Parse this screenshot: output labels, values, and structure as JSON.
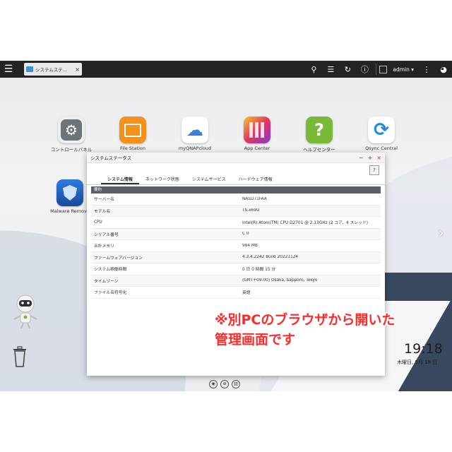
{
  "topbar": {
    "tab_label": "システムステ...",
    "tab_close": "×",
    "user": "admin ▾",
    "icons": [
      "menu-icon",
      "search-icon",
      "stack-icon",
      "sync-icon",
      "info-icon",
      "user-icon",
      "more-icon",
      "dashboard-icon"
    ]
  },
  "desktop": {
    "icons": [
      {
        "label": "コントロールパネル",
        "color": "#7a7f86",
        "icon": "gear-icon",
        "glyph": "⚙"
      },
      {
        "label": "File Station",
        "color": "#f2921d",
        "icon": "folder-icon",
        "glyph": "▬"
      },
      {
        "label": "myQNAPcloud",
        "color": "#ffffff",
        "icon": "cloud-icon",
        "glyph": "☁"
      },
      {
        "label": "App Center",
        "color": "#e23c6b",
        "icon": "grid-icon",
        "glyph": "▦"
      },
      {
        "label": "ヘルプセンター",
        "color": "#7ab83a",
        "icon": "help-icon",
        "glyph": "?"
      },
      {
        "label": "Qsync Central",
        "color": "#ffffff",
        "icon": "sync-icon",
        "glyph": "⟳"
      },
      {
        "label": "Malware Remove",
        "color": "#1d5fbf",
        "icon": "shield-icon",
        "glyph": "◆"
      }
    ]
  },
  "window": {
    "title": "システムステータス",
    "controls": [
      "−",
      "+",
      "×"
    ],
    "help": "?",
    "tabs": [
      "システム情報",
      "ネットワーク状態",
      "システムサービス",
      "ハードウェア情報"
    ],
    "section": "要約",
    "rows": [
      {
        "k": "サーバー名",
        "v": "NASD71FAA"
      },
      {
        "k": "モデル名",
        "v": "TS-x69U"
      },
      {
        "k": "CPU",
        "v": "Intel(R) Atom(TM) CPU D2701 @ 2.13GHz (2 コア、4 スレッド)"
      },
      {
        "k": "シリアル番号",
        "v": "C            0"
      },
      {
        "k": "合計メモリ",
        "v": "984 MB"
      },
      {
        "k": "ファームウェアバージョン",
        "v": "4.3.4.2242 Build 20221124"
      },
      {
        "k": "システム稼働時間",
        "v": "0 日 0 時間 15 分"
      },
      {
        "k": "タイムゾーン",
        "v": "(GMT+09:00) Osaka, Sapporo, Tokyo"
      },
      {
        "k": "ファイル名符号化",
        "v": "英語"
      }
    ]
  },
  "clock": {
    "time": "19:18",
    "date": "木曜日, 5月 18 日"
  },
  "overlay": {
    "line1": "※別PCのブラウザから開いた",
    "line2": "管理画面です"
  },
  "colors": {
    "topbar": "#222324",
    "section": "#5b6068",
    "overlay_text": "#ff2b2b"
  }
}
